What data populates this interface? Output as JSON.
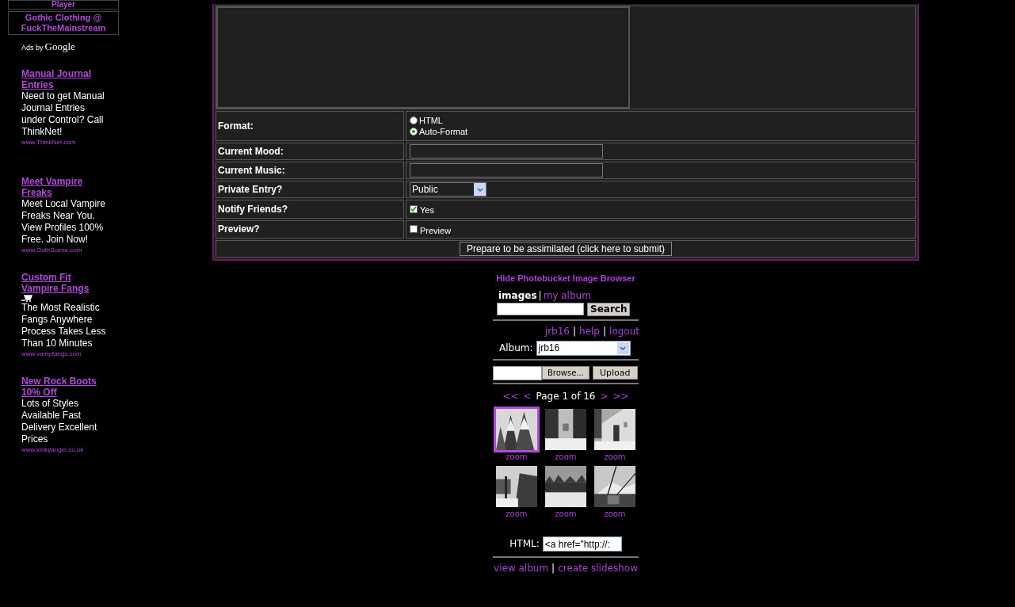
{
  "sidebar": {
    "top_box": "Player",
    "promo": "Gothic Clothing @ FuckTheMainstream",
    "ads_label": "Ads by",
    "ads_brand": "Google",
    "ads": [
      {
        "kind": "plain",
        "title": "Manual Journal Entries",
        "body": "Need to get Manual Journal Entries under Control? Call ThinkNet!",
        "url": "www.ThinkNet.com"
      },
      {
        "kind": "plain",
        "title": "Meet Vampire Freaks",
        "body": "Meet Local Vampire Freaks Near You. View Profiles 100% Free. Join Now!",
        "url": "www.GothScene.com"
      },
      {
        "kind": "cart",
        "title": "Custom Fit Vampire Fangs",
        "body": "The Most Realistic Fangs Anywhere Process Takes Less Than 10 Minutes",
        "url": "www.vampfangs.com"
      },
      {
        "kind": "plain",
        "title": "New Rock Boots 10% Off",
        "body": "Lots of Styles Available Fast Delivery Excellent Prices",
        "url": "www.kinkyangel.co.uk"
      }
    ]
  },
  "form": {
    "rows": [
      {
        "kind": "radio",
        "label": "Format:",
        "options": [
          {
            "label": "HTML",
            "selected": false
          },
          {
            "label": "Auto-Format",
            "selected": true
          }
        ]
      },
      {
        "kind": "text",
        "label": "Current Mood:"
      },
      {
        "kind": "text",
        "label": "Current Music:"
      },
      {
        "kind": "select",
        "label": "Private Entry?",
        "value": "Public"
      },
      {
        "kind": "checkbox",
        "label": "Notify Friends?",
        "option": "Yes",
        "checked": true
      },
      {
        "kind": "checkbox",
        "label": "Preview?",
        "option": "Preview",
        "checked": false
      }
    ],
    "submit": "Prepare to be assimilated (click here to submit)"
  },
  "photobucket": {
    "hide_link": "Hide Photobucket Image Browser",
    "tabs": [
      {
        "label": "images",
        "selected": true
      },
      {
        "label": "my album",
        "selected": false
      }
    ],
    "tab_separator": "|",
    "search_button": "Search",
    "user_links": [
      {
        "kind": "link",
        "text": "jrb16"
      },
      {
        "kind": "separator",
        "text": "|"
      },
      {
        "kind": "link",
        "text": "help"
      },
      {
        "kind": "separator",
        "text": "|"
      },
      {
        "kind": "link",
        "text": "logout"
      }
    ],
    "album_label": "Album:",
    "album_value": "jrb16",
    "browse_button": "Browse...",
    "upload_button": "Upload",
    "pager": {
      "first": "<<",
      "prev": "<",
      "text": "Page 1 of 16",
      "next": ">",
      "last": ">>"
    },
    "thumbnails": [
      {
        "selected": true,
        "zoom": "zoom"
      },
      {
        "selected": false,
        "zoom": "zoom"
      },
      {
        "selected": false,
        "zoom": "zoom"
      },
      {
        "selected": false,
        "zoom": "zoom"
      },
      {
        "selected": false,
        "zoom": "zoom"
      },
      {
        "selected": false,
        "zoom": "zoom"
      }
    ],
    "html_label": "HTML:",
    "html_value": "<a href=\"http://:",
    "footer_links": [
      {
        "kind": "link",
        "text": "view album"
      },
      {
        "kind": "separator",
        "text": "|"
      },
      {
        "kind": "link",
        "text": "create slideshow"
      }
    ]
  }
}
